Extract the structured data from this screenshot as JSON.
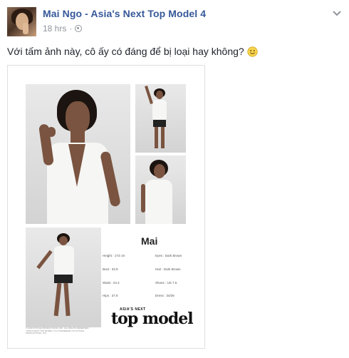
{
  "post": {
    "author": "Mai Ngo - Asia's Next Top Model 4",
    "time": "18 hrs",
    "separator": "·",
    "privacy_icon": "globe-icon",
    "menu_icon": "chevron-down-icon",
    "caption": "Với tấm ảnh này, cô ấy có đáng để bị loại hay không?",
    "emoji": "smiley-icon"
  },
  "comp_card": {
    "name": "Mai",
    "stats": [
      {
        "label": "Height : 173 cm"
      },
      {
        "label": "Eyes : Dark Brown"
      },
      {
        "label": "Bust : 33.9"
      },
      {
        "label": "Hair : Dark Brown"
      },
      {
        "label": "Waist : 24.4"
      },
      {
        "label": "Shoes : US 7.5"
      },
      {
        "label": "Hips : 37.8"
      },
      {
        "label": "Dress : 34/36"
      }
    ],
    "fineprint": "© 2016 FOTOLE PRODUCTIONS, INC. ALL RIGHTS RESERVED. \"ASIA'S NEXT TOP MODEL\" IS A TRADEMARK OF FOTOLE PRODUCTIONS, INC.",
    "logo_top": "ASIA'S NEXT",
    "logo_main": "top model"
  },
  "colors": {
    "link": "#365899",
    "meta": "#90949c",
    "text": "#1d2129"
  }
}
